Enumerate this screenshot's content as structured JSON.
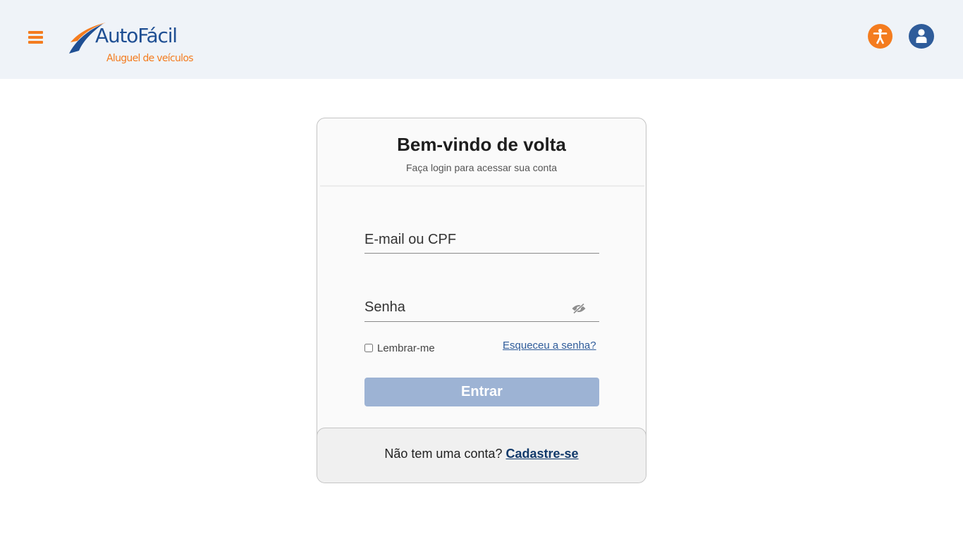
{
  "header": {
    "menu_icon": "hamburger-menu-icon",
    "logo": {
      "name": "AutoFácil",
      "tagline": "Aluguel de veículos"
    },
    "accessibility_icon": "accessibility-icon",
    "account_icon": "user-account-icon"
  },
  "login": {
    "title": "Bem-vindo de volta",
    "subtitle": "Faça login para acessar sua conta",
    "email_placeholder": "E-mail ou CPF",
    "email_value": "",
    "password_placeholder": "Senha",
    "password_value": "",
    "password_toggle_icon": "eye-slash-icon",
    "remember_label": "Lembrar-me",
    "remember_checked": false,
    "forgot_link": "Esqueceu a senha?",
    "submit_label": "Entrar",
    "signup_prompt": "Não tem uma conta?",
    "signup_link": "Cadastre-se"
  },
  "colors": {
    "brand_orange": "#f47c1f",
    "brand_blue": "#1f4f93",
    "header_bg": "#eff3f8",
    "button_disabled": "#9db3d4"
  }
}
